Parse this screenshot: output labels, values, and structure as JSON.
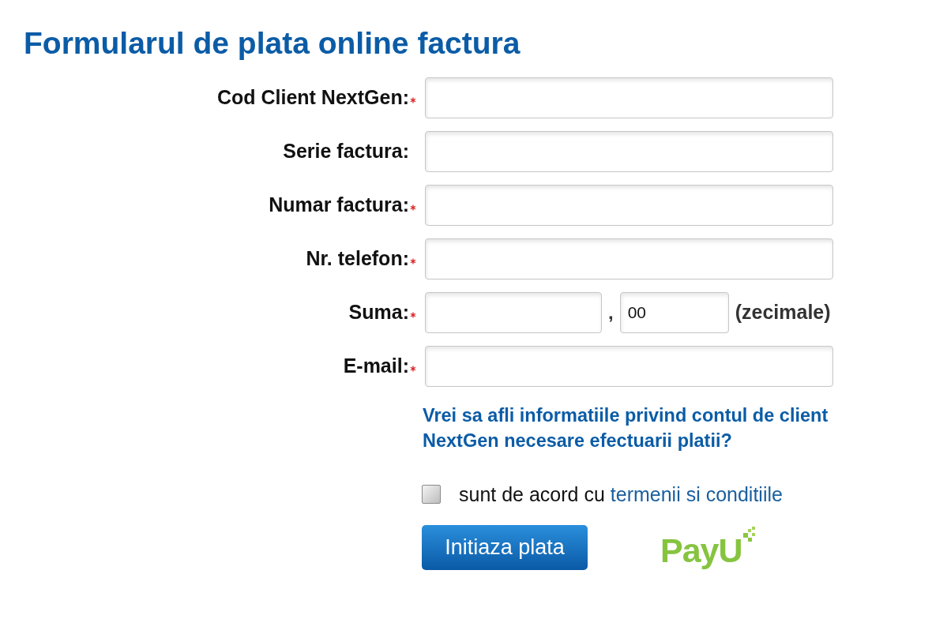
{
  "title": "Formularul de plata online factura",
  "fields": [
    {
      "kind": "text",
      "label": "Cod Client NextGen:",
      "required": true
    },
    {
      "kind": "text",
      "label": "Serie factura:",
      "required": false
    },
    {
      "kind": "text",
      "label": "Numar factura:",
      "required": true
    },
    {
      "kind": "text",
      "label": "Nr. telefon:",
      "required": true
    },
    {
      "kind": "amount",
      "label": "Suma:",
      "required": true,
      "separator": ",",
      "decimals_value": "00",
      "suffix": "(zecimale)"
    },
    {
      "kind": "text",
      "label": "E-mail:",
      "required": true
    }
  ],
  "info_link": "Vrei sa afli informatiile privind contul de client NextGen necesare efectuarii platii?",
  "agreement": {
    "checked": false,
    "text": "sunt de acord cu",
    "link": "termenii si conditiile"
  },
  "submit_button": "Initiaza plata",
  "payment_logo": "PayU"
}
